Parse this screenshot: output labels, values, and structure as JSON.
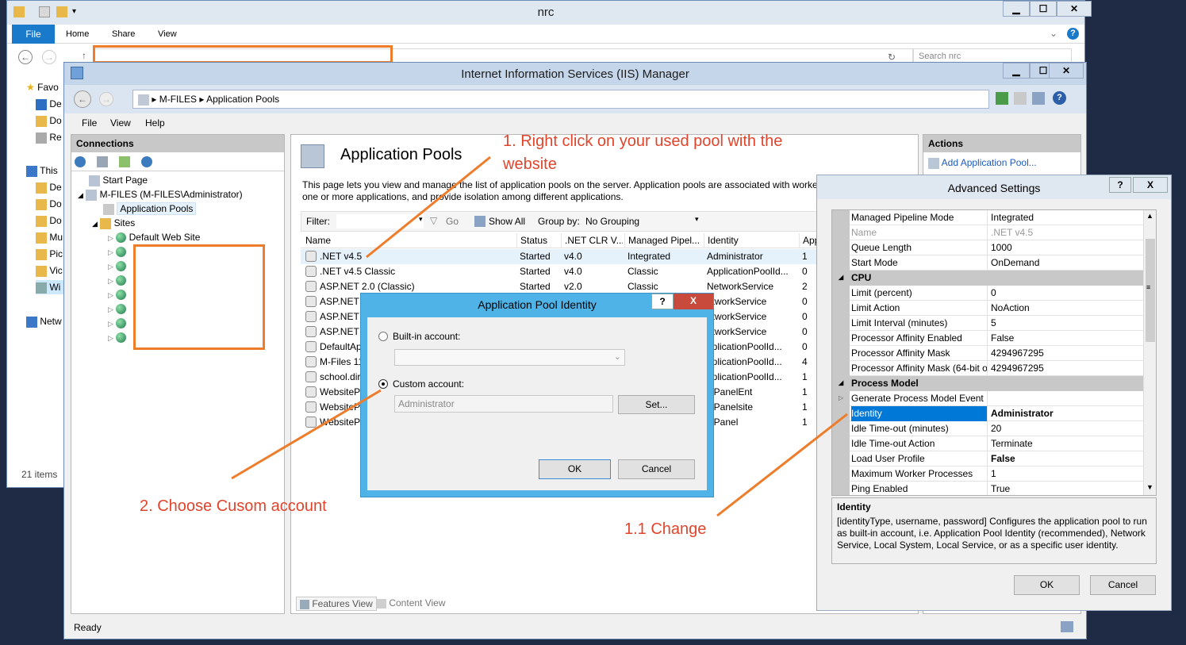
{
  "explorer": {
    "title": "nrc",
    "ribbon_tabs": [
      "File",
      "Home",
      "Share",
      "View"
    ],
    "search_placeholder": "Search nrc",
    "nav_items": [
      "Favo",
      "De",
      "Do",
      "Re",
      "This",
      "De",
      "Do",
      "Do",
      "Mu",
      "Pic",
      "Vic",
      "Wi",
      "Netw"
    ],
    "items_count": "21 items"
  },
  "iis": {
    "title": "Internet Information Services (IIS) Manager",
    "breadcrumb": [
      "M-FILES",
      "Application Pools"
    ],
    "menu": [
      "File",
      "View",
      "Help"
    ],
    "connections_title": "Connections",
    "tree": {
      "start_page": "Start Page",
      "server": "M-FILES (M-FILES\\Administrator)",
      "app_pools": "Application Pools",
      "sites": "Sites",
      "default_site": "Default Web Site"
    },
    "page_title": "Application Pools",
    "description": "This page lets you view and manage the list of application pools on the server. Application pools are associated with worker processes, contain one or more applications, and provide isolation among different applications.",
    "filter_label": "Filter:",
    "go_label": "Go",
    "show_all_label": "Show All",
    "group_by_label": "Group by:",
    "group_by_value": "No Grouping",
    "columns": [
      "Name",
      "Status",
      ".NET CLR V...",
      "Managed Pipel...",
      "Identity",
      "App"
    ],
    "rows": [
      {
        "name": ".NET v4.5",
        "status": "Started",
        "clr": "v4.0",
        "pipeline": "Integrated",
        "identity": "Administrator",
        "apps": "1"
      },
      {
        "name": ".NET v4.5 Classic",
        "status": "Started",
        "clr": "v4.0",
        "pipeline": "Classic",
        "identity": "ApplicationPoolId...",
        "apps": "0"
      },
      {
        "name": "ASP.NET 2.0 (Classic)",
        "status": "Started",
        "clr": "v2.0",
        "pipeline": "Classic",
        "identity": "NetworkService",
        "apps": "2"
      },
      {
        "name": "ASP.NET 2",
        "status": "",
        "clr": "",
        "pipeline": "",
        "identity": "etworkService",
        "apps": "0"
      },
      {
        "name": "ASP.NET 4",
        "status": "",
        "clr": "",
        "pipeline": "",
        "identity": "etworkService",
        "apps": "0"
      },
      {
        "name": "ASP.NET 4",
        "status": "",
        "clr": "",
        "pipeline": "",
        "identity": "etworkService",
        "apps": "0"
      },
      {
        "name": "DefaultAp",
        "status": "",
        "clr": "",
        "pipeline": "",
        "identity": "pplicationPoolId...",
        "apps": "0"
      },
      {
        "name": "M-Files 11",
        "status": "",
        "clr": "",
        "pipeline": "",
        "identity": "pplicationPoolId...",
        "apps": "4"
      },
      {
        "name": "school.dir",
        "status": "",
        "clr": "",
        "pipeline": "",
        "identity": "pplicationPoolId...",
        "apps": "1"
      },
      {
        "name": "WebsitePa",
        "status": "",
        "clr": "",
        "pipeline": "",
        "identity": "lsPanelEnt",
        "apps": "1"
      },
      {
        "name": "WebsitePa",
        "status": "",
        "clr": "",
        "pipeline": "",
        "identity": "lsPanelsite",
        "apps": "1"
      },
      {
        "name": "WebsitePa",
        "status": "",
        "clr": "",
        "pipeline": "",
        "identity": "lsPanel",
        "apps": "1"
      }
    ],
    "features_view": "Features View",
    "content_view": "Content View",
    "status": "Ready",
    "actions_title": "Actions",
    "add_pool": "Add Application Pool..."
  },
  "identity_dialog": {
    "title": "Application Pool Identity",
    "builtin_label": "Built-in account:",
    "custom_label": "Custom account:",
    "custom_value": "Administrator",
    "set_label": "Set...",
    "ok_label": "OK",
    "cancel_label": "Cancel",
    "help": "?",
    "close": "X"
  },
  "advanced": {
    "title": "Advanced Settings",
    "help": "?",
    "close": "X",
    "rows": [
      {
        "type": "prop",
        "k": "Managed Pipeline Mode",
        "v": "Integrated"
      },
      {
        "type": "prop",
        "k": "Name",
        "v": ".NET v4.5",
        "muted": true
      },
      {
        "type": "prop",
        "k": "Queue Length",
        "v": "1000"
      },
      {
        "type": "prop",
        "k": "Start Mode",
        "v": "OnDemand"
      },
      {
        "type": "cat",
        "k": "CPU"
      },
      {
        "type": "prop",
        "k": "Limit (percent)",
        "v": "0"
      },
      {
        "type": "prop",
        "k": "Limit Action",
        "v": "NoAction"
      },
      {
        "type": "prop",
        "k": "Limit Interval (minutes)",
        "v": "5"
      },
      {
        "type": "prop",
        "k": "Processor Affinity Enabled",
        "v": "False"
      },
      {
        "type": "prop",
        "k": "Processor Affinity Mask",
        "v": "4294967295"
      },
      {
        "type": "prop",
        "k": "Processor Affinity Mask (64-bit o",
        "v": "4294967295"
      },
      {
        "type": "cat",
        "k": "Process Model"
      },
      {
        "type": "prop",
        "k": "Generate Process Model Event L",
        "v": "",
        "expand": true
      },
      {
        "type": "prop",
        "k": "Identity",
        "v": "Administrator",
        "selected": true,
        "bold": true
      },
      {
        "type": "prop",
        "k": "Idle Time-out (minutes)",
        "v": "20"
      },
      {
        "type": "prop",
        "k": "Idle Time-out Action",
        "v": "Terminate"
      },
      {
        "type": "prop",
        "k": "Load User Profile",
        "v": "False",
        "bold": true
      },
      {
        "type": "prop",
        "k": "Maximum Worker Processes",
        "v": "1"
      },
      {
        "type": "prop",
        "k": "Ping Enabled",
        "v": "True"
      }
    ],
    "desc_title": "Identity",
    "desc_text": "[identityType, username, password] Configures the application pool to run as built-in account, i.e. Application Pool Identity (recommended), Network Service, Local System, Local Service, or as a specific user identity.",
    "ok_label": "OK",
    "cancel_label": "Cancel"
  },
  "annotations": {
    "step1_line1": "1. Right click on your used pool with the",
    "step1_line2": "website",
    "step2": "2. Choose Cusom account",
    "step11": "1.1 Change"
  },
  "colors": {
    "annotation": "#e0452c",
    "highlight": "#ee7d2b",
    "dialog_border": "#4fb3e8",
    "selection": "#cce8ff"
  }
}
